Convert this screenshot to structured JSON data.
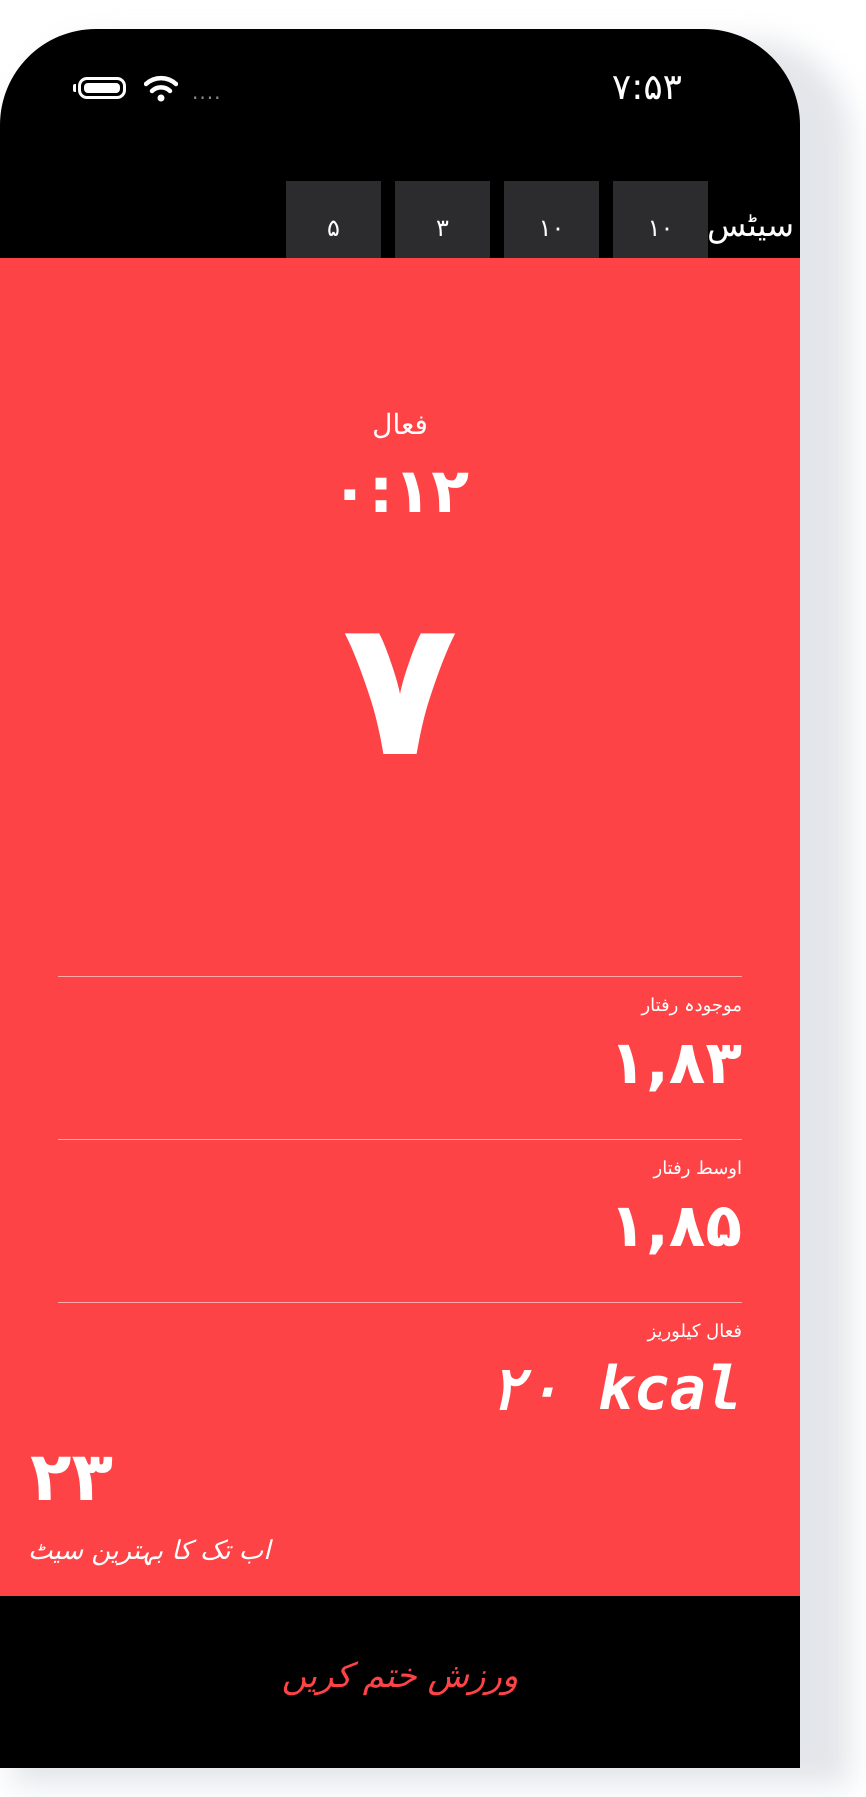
{
  "status_bar": {
    "time": "۷:۵۳",
    "signal_dots": "....",
    "icons": [
      "battery-icon",
      "wifi-icon",
      "signal-icon"
    ]
  },
  "sets": {
    "label": "سیٹس",
    "values": [
      "۱۰",
      "۱۰",
      "۳",
      "۵"
    ]
  },
  "workout": {
    "state_label": "فعال",
    "timer": "۰:۱۲",
    "reps": "۷"
  },
  "metrics": {
    "current_speed": {
      "label": "موجودہ رفتار",
      "value": "۱,۸۳"
    },
    "average_speed": {
      "label": "اوسط رفتار",
      "value": "۱,۸۵"
    },
    "active_calories": {
      "label": "فعال کیلوریز",
      "value": "۲۰ kcal"
    }
  },
  "best_set": {
    "value": "۲۳",
    "label": "اب تک کا بہترین سیٹ"
  },
  "end_button": {
    "label": "ورزش ختم کریں"
  },
  "colors": {
    "accent_red": "#fe4346",
    "background": "#000000",
    "set_box": "#2c2c2e"
  }
}
